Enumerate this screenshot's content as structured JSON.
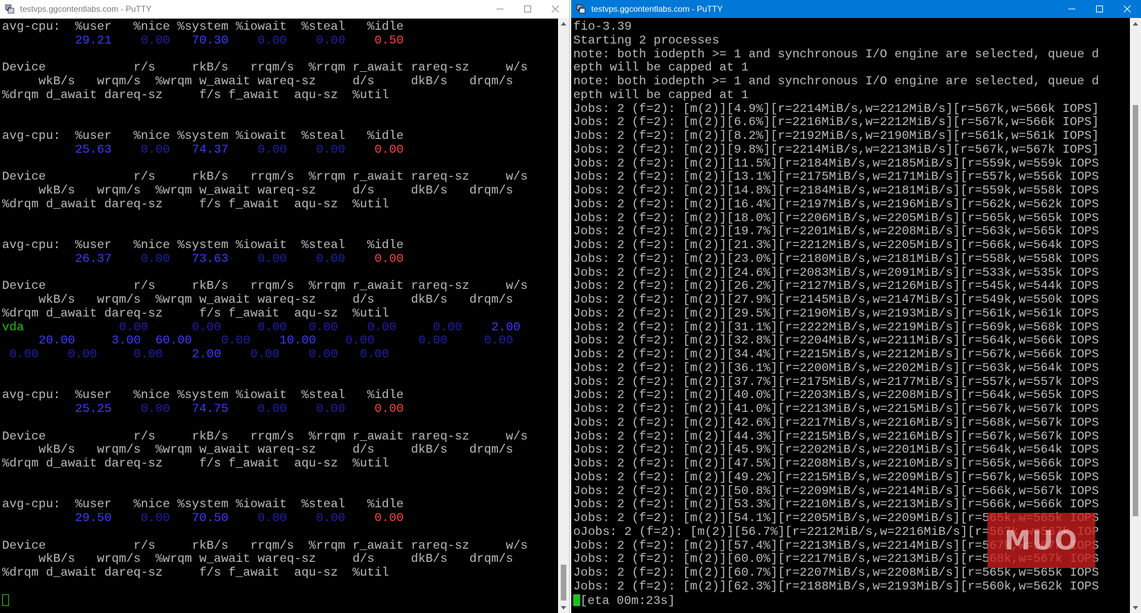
{
  "left_window": {
    "title": "testvps.ggcontentlabs.com - PuTTY",
    "lines": [
      [
        {
          "t": "avg-cpu:  %user   %nice %system %iowait  %steal   %idle"
        }
      ],
      [
        {
          "t": "          "
        },
        {
          "t": "29.21",
          "c": "c-blue"
        },
        {
          "t": "    "
        },
        {
          "t": "0.00",
          "c": "c-dblue"
        },
        {
          "t": "   "
        },
        {
          "t": "70.30",
          "c": "c-blue"
        },
        {
          "t": "    "
        },
        {
          "t": "0.00",
          "c": "c-dblue"
        },
        {
          "t": "    "
        },
        {
          "t": "0.00",
          "c": "c-dblue"
        },
        {
          "t": "    "
        },
        {
          "t": "0.50",
          "c": "c-red"
        }
      ],
      [
        {
          "t": ""
        }
      ],
      [
        {
          "t": "Device            r/s     rkB/s   rrqm/s  %rrqm r_await rareq-sz     w/s"
        }
      ],
      [
        {
          "t": "     wkB/s   wrqm/s  %wrqm w_await wareq-sz     d/s     dkB/s   drqm/s"
        }
      ],
      [
        {
          "t": "%drqm d_await dareq-sz     f/s f_await  aqu-sz  %util"
        }
      ],
      [
        {
          "t": ""
        }
      ],
      [
        {
          "t": ""
        }
      ],
      [
        {
          "t": "avg-cpu:  %user   %nice %system %iowait  %steal   %idle"
        }
      ],
      [
        {
          "t": "          "
        },
        {
          "t": "25.63",
          "c": "c-blue"
        },
        {
          "t": "    "
        },
        {
          "t": "0.00",
          "c": "c-dblue"
        },
        {
          "t": "   "
        },
        {
          "t": "74.37",
          "c": "c-blue"
        },
        {
          "t": "    "
        },
        {
          "t": "0.00",
          "c": "c-dblue"
        },
        {
          "t": "    "
        },
        {
          "t": "0.00",
          "c": "c-dblue"
        },
        {
          "t": "    "
        },
        {
          "t": "0.00",
          "c": "c-red"
        }
      ],
      [
        {
          "t": ""
        }
      ],
      [
        {
          "t": "Device            r/s     rkB/s   rrqm/s  %rrqm r_await rareq-sz     w/s"
        }
      ],
      [
        {
          "t": "     wkB/s   wrqm/s  %wrqm w_await wareq-sz     d/s     dkB/s   drqm/s"
        }
      ],
      [
        {
          "t": "%drqm d_await dareq-sz     f/s f_await  aqu-sz  %util"
        }
      ],
      [
        {
          "t": ""
        }
      ],
      [
        {
          "t": ""
        }
      ],
      [
        {
          "t": "avg-cpu:  %user   %nice %system %iowait  %steal   %idle"
        }
      ],
      [
        {
          "t": "          "
        },
        {
          "t": "26.37",
          "c": "c-blue"
        },
        {
          "t": "    "
        },
        {
          "t": "0.00",
          "c": "c-dblue"
        },
        {
          "t": "   "
        },
        {
          "t": "73.63",
          "c": "c-blue"
        },
        {
          "t": "    "
        },
        {
          "t": "0.00",
          "c": "c-dblue"
        },
        {
          "t": "    "
        },
        {
          "t": "0.00",
          "c": "c-dblue"
        },
        {
          "t": "    "
        },
        {
          "t": "0.00",
          "c": "c-red"
        }
      ],
      [
        {
          "t": ""
        }
      ],
      [
        {
          "t": "Device            r/s     rkB/s   rrqm/s  %rrqm r_await rareq-sz     w/s"
        }
      ],
      [
        {
          "t": "     wkB/s   wrqm/s  %wrqm w_await wareq-sz     d/s     dkB/s   drqm/s"
        }
      ],
      [
        {
          "t": "%drqm d_await dareq-sz     f/s f_await  aqu-sz  %util"
        }
      ],
      [
        {
          "t": "vda",
          "c": "c-green"
        },
        {
          "t": "             "
        },
        {
          "t": "0.00",
          "c": "c-dblue"
        },
        {
          "t": "      "
        },
        {
          "t": "0.00",
          "c": "c-dblue"
        },
        {
          "t": "     "
        },
        {
          "t": "0.00",
          "c": "c-dblue"
        },
        {
          "t": "   "
        },
        {
          "t": "0.00",
          "c": "c-dblue"
        },
        {
          "t": "    "
        },
        {
          "t": "0.00",
          "c": "c-dblue"
        },
        {
          "t": "     "
        },
        {
          "t": "0.00",
          "c": "c-dblue"
        },
        {
          "t": "    "
        },
        {
          "t": "2.00",
          "c": "c-blue"
        }
      ],
      [
        {
          "t": "     "
        },
        {
          "t": "20.00",
          "c": "c-blue"
        },
        {
          "t": "     "
        },
        {
          "t": "3.00",
          "c": "c-blue"
        },
        {
          "t": "  "
        },
        {
          "t": "60.00",
          "c": "c-blue"
        },
        {
          "t": "    "
        },
        {
          "t": "0.00",
          "c": "c-dblue"
        },
        {
          "t": "    "
        },
        {
          "t": "10.00",
          "c": "c-blue"
        },
        {
          "t": "    "
        },
        {
          "t": "0.00",
          "c": "c-dblue"
        },
        {
          "t": "      "
        },
        {
          "t": "0.00",
          "c": "c-dblue"
        },
        {
          "t": "     "
        },
        {
          "t": "0.00",
          "c": "c-dblue"
        }
      ],
      [
        {
          "t": " "
        },
        {
          "t": "0.00",
          "c": "c-dblue"
        },
        {
          "t": "    "
        },
        {
          "t": "0.00",
          "c": "c-dblue"
        },
        {
          "t": "     "
        },
        {
          "t": "0.00",
          "c": "c-dblue"
        },
        {
          "t": "    "
        },
        {
          "t": "2.00",
          "c": "c-blue"
        },
        {
          "t": "    "
        },
        {
          "t": "0.00",
          "c": "c-dblue"
        },
        {
          "t": "    "
        },
        {
          "t": "0.00",
          "c": "c-dblue"
        },
        {
          "t": "   "
        },
        {
          "t": "0.00",
          "c": "c-dblue"
        }
      ],
      [
        {
          "t": ""
        }
      ],
      [
        {
          "t": ""
        }
      ],
      [
        {
          "t": "avg-cpu:  %user   %nice %system %iowait  %steal   %idle"
        }
      ],
      [
        {
          "t": "          "
        },
        {
          "t": "25.25",
          "c": "c-blue"
        },
        {
          "t": "    "
        },
        {
          "t": "0.00",
          "c": "c-dblue"
        },
        {
          "t": "   "
        },
        {
          "t": "74.75",
          "c": "c-blue"
        },
        {
          "t": "    "
        },
        {
          "t": "0.00",
          "c": "c-dblue"
        },
        {
          "t": "    "
        },
        {
          "t": "0.00",
          "c": "c-dblue"
        },
        {
          "t": "    "
        },
        {
          "t": "0.00",
          "c": "c-red"
        }
      ],
      [
        {
          "t": ""
        }
      ],
      [
        {
          "t": "Device            r/s     rkB/s   rrqm/s  %rrqm r_await rareq-sz     w/s"
        }
      ],
      [
        {
          "t": "     wkB/s   wrqm/s  %wrqm w_await wareq-sz     d/s     dkB/s   drqm/s"
        }
      ],
      [
        {
          "t": "%drqm d_await dareq-sz     f/s f_await  aqu-sz  %util"
        }
      ],
      [
        {
          "t": ""
        }
      ],
      [
        {
          "t": ""
        }
      ],
      [
        {
          "t": "avg-cpu:  %user   %nice %system %iowait  %steal   %idle"
        }
      ],
      [
        {
          "t": "          "
        },
        {
          "t": "29.50",
          "c": "c-blue"
        },
        {
          "t": "    "
        },
        {
          "t": "0.00",
          "c": "c-dblue"
        },
        {
          "t": "   "
        },
        {
          "t": "70.50",
          "c": "c-blue"
        },
        {
          "t": "    "
        },
        {
          "t": "0.00",
          "c": "c-dblue"
        },
        {
          "t": "    "
        },
        {
          "t": "0.00",
          "c": "c-dblue"
        },
        {
          "t": "    "
        },
        {
          "t": "0.00",
          "c": "c-red"
        }
      ],
      [
        {
          "t": ""
        }
      ],
      [
        {
          "t": "Device            r/s     rkB/s   rrqm/s  %rrqm r_await rareq-sz     w/s"
        }
      ],
      [
        {
          "t": "     wkB/s   wrqm/s  %wrqm w_await wareq-sz     d/s     dkB/s   drqm/s"
        }
      ],
      [
        {
          "t": "%drqm d_await dareq-sz     f/s f_await  aqu-sz  %util"
        }
      ],
      [
        {
          "t": ""
        }
      ]
    ]
  },
  "right_window": {
    "title": "testvps.ggcontentlabs.com - PuTTY",
    "lines": [
      "fio-3.39",
      "Starting 2 processes",
      "note: both iodepth >= 1 and synchronous I/O engine are selected, queue d",
      "epth will be capped at 1",
      "note: both iodepth >= 1 and synchronous I/O engine are selected, queue d",
      "epth will be capped at 1",
      "Jobs: 2 (f=2): [m(2)][4.9%][r=2214MiB/s,w=2212MiB/s][r=567k,w=566k IOPS]",
      "Jobs: 2 (f=2): [m(2)][6.6%][r=2216MiB/s,w=2212MiB/s][r=567k,w=566k IOPS]",
      "Jobs: 2 (f=2): [m(2)][8.2%][r=2192MiB/s,w=2190MiB/s][r=561k,w=561k IOPS]",
      "Jobs: 2 (f=2): [m(2)][9.8%][r=2214MiB/s,w=2213MiB/s][r=567k,w=567k IOPS]",
      "Jobs: 2 (f=2): [m(2)][11.5%][r=2184MiB/s,w=2185MiB/s][r=559k,w=559k IOPS",
      "Jobs: 2 (f=2): [m(2)][13.1%][r=2175MiB/s,w=2171MiB/s][r=557k,w=556k IOPS",
      "Jobs: 2 (f=2): [m(2)][14.8%][r=2184MiB/s,w=2181MiB/s][r=559k,w=558k IOPS",
      "Jobs: 2 (f=2): [m(2)][16.4%][r=2197MiB/s,w=2196MiB/s][r=562k,w=562k IOPS",
      "Jobs: 2 (f=2): [m(2)][18.0%][r=2206MiB/s,w=2205MiB/s][r=565k,w=565k IOPS",
      "Jobs: 2 (f=2): [m(2)][19.7%][r=2201MiB/s,w=2208MiB/s][r=563k,w=565k IOPS",
      "Jobs: 2 (f=2): [m(2)][21.3%][r=2212MiB/s,w=2205MiB/s][r=566k,w=564k IOPS",
      "Jobs: 2 (f=2): [m(2)][23.0%][r=2180MiB/s,w=2181MiB/s][r=558k,w=558k IOPS",
      "Jobs: 2 (f=2): [m(2)][24.6%][r=2083MiB/s,w=2091MiB/s][r=533k,w=535k IOPS",
      "Jobs: 2 (f=2): [m(2)][26.2%][r=2127MiB/s,w=2126MiB/s][r=545k,w=544k IOPS",
      "Jobs: 2 (f=2): [m(2)][27.9%][r=2145MiB/s,w=2147MiB/s][r=549k,w=550k IOPS",
      "Jobs: 2 (f=2): [m(2)][29.5%][r=2190MiB/s,w=2193MiB/s][r=561k,w=561k IOPS",
      "Jobs: 2 (f=2): [m(2)][31.1%][r=2222MiB/s,w=2219MiB/s][r=569k,w=568k IOPS",
      "Jobs: 2 (f=2): [m(2)][32.8%][r=2204MiB/s,w=2211MiB/s][r=564k,w=566k IOPS",
      "Jobs: 2 (f=2): [m(2)][34.4%][r=2215MiB/s,w=2212MiB/s][r=567k,w=566k IOPS",
      "Jobs: 2 (f=2): [m(2)][36.1%][r=2200MiB/s,w=2202MiB/s][r=563k,w=564k IOPS",
      "Jobs: 2 (f=2): [m(2)][37.7%][r=2175MiB/s,w=2177MiB/s][r=557k,w=557k IOPS",
      "Jobs: 2 (f=2): [m(2)][40.0%][r=2203MiB/s,w=2208MiB/s][r=564k,w=565k IOPS",
      "Jobs: 2 (f=2): [m(2)][41.0%][r=2213MiB/s,w=2215MiB/s][r=567k,w=567k IOPS",
      "Jobs: 2 (f=2): [m(2)][42.6%][r=2217MiB/s,w=2216MiB/s][r=568k,w=567k IOPS",
      "Jobs: 2 (f=2): [m(2)][44.3%][r=2215MiB/s,w=2216MiB/s][r=567k,w=567k IOPS",
      "Jobs: 2 (f=2): [m(2)][45.9%][r=2202MiB/s,w=2201MiB/s][r=564k,w=564k IOPS",
      "Jobs: 2 (f=2): [m(2)][47.5%][r=2208MiB/s,w=2210MiB/s][r=565k,w=566k IOPS",
      "Jobs: 2 (f=2): [m(2)][49.2%][r=2215MiB/s,w=2209MiB/s][r=567k,w=565k IOPS",
      "Jobs: 2 (f=2): [m(2)][50.8%][r=2209MiB/s,w=2214MiB/s][r=566k,w=567k IOPS",
      "Jobs: 2 (f=2): [m(2)][53.3%][r=2210MiB/s,w=2213MiB/s][r=566k,w=566k IOPS",
      "Jobs: 2 (f=2): [m(2)][54.1%][r=2205MiB/s,w=2209MiB/s][r=565k,w=565k IOPS",
      "oJobs: 2 (f=2): [m(2)][56.7%][r=2212MiB/s,w=2216MiB/s][r=567k,w=567k IOP",
      "Jobs: 2 (f=2): [m(2)][57.4%][r=2213MiB/s,w=2214MiB/s][r=567k,w=567k IOPS",
      "Jobs: 2 (f=2): [m(2)][60.0%][r=2217MiB/s,w=2213MiB/s][r=568k,w=567k IOPS",
      "Jobs: 2 (f=2): [m(2)][60.7%][r=2207MiB/s,w=2208MiB/s][r=565k,w=565k IOPS",
      "Jobs: 2 (f=2): [m(2)][62.3%][r=2188MiB/s,w=2193MiB/s][r=560k,w=562k IOPS"
    ],
    "prompt_line": "[eta 00m:23s]"
  },
  "watermark": "MUO",
  "colors": {
    "terminal_bg": "#000000",
    "terminal_text": "#bbbbbb",
    "value_blue": "#3b3bff",
    "value_dark_blue": "#1f1fa8",
    "value_red": "#ff4040",
    "device_green": "#1fbf1f",
    "active_titlebar": "#0078d7",
    "watermark_red": "#cd1e1e"
  },
  "icons": [
    "putty-icon",
    "minimize-icon",
    "maximize-icon",
    "close-icon",
    "scroll-up-arrow-icon",
    "scroll-down-arrow-icon"
  ]
}
